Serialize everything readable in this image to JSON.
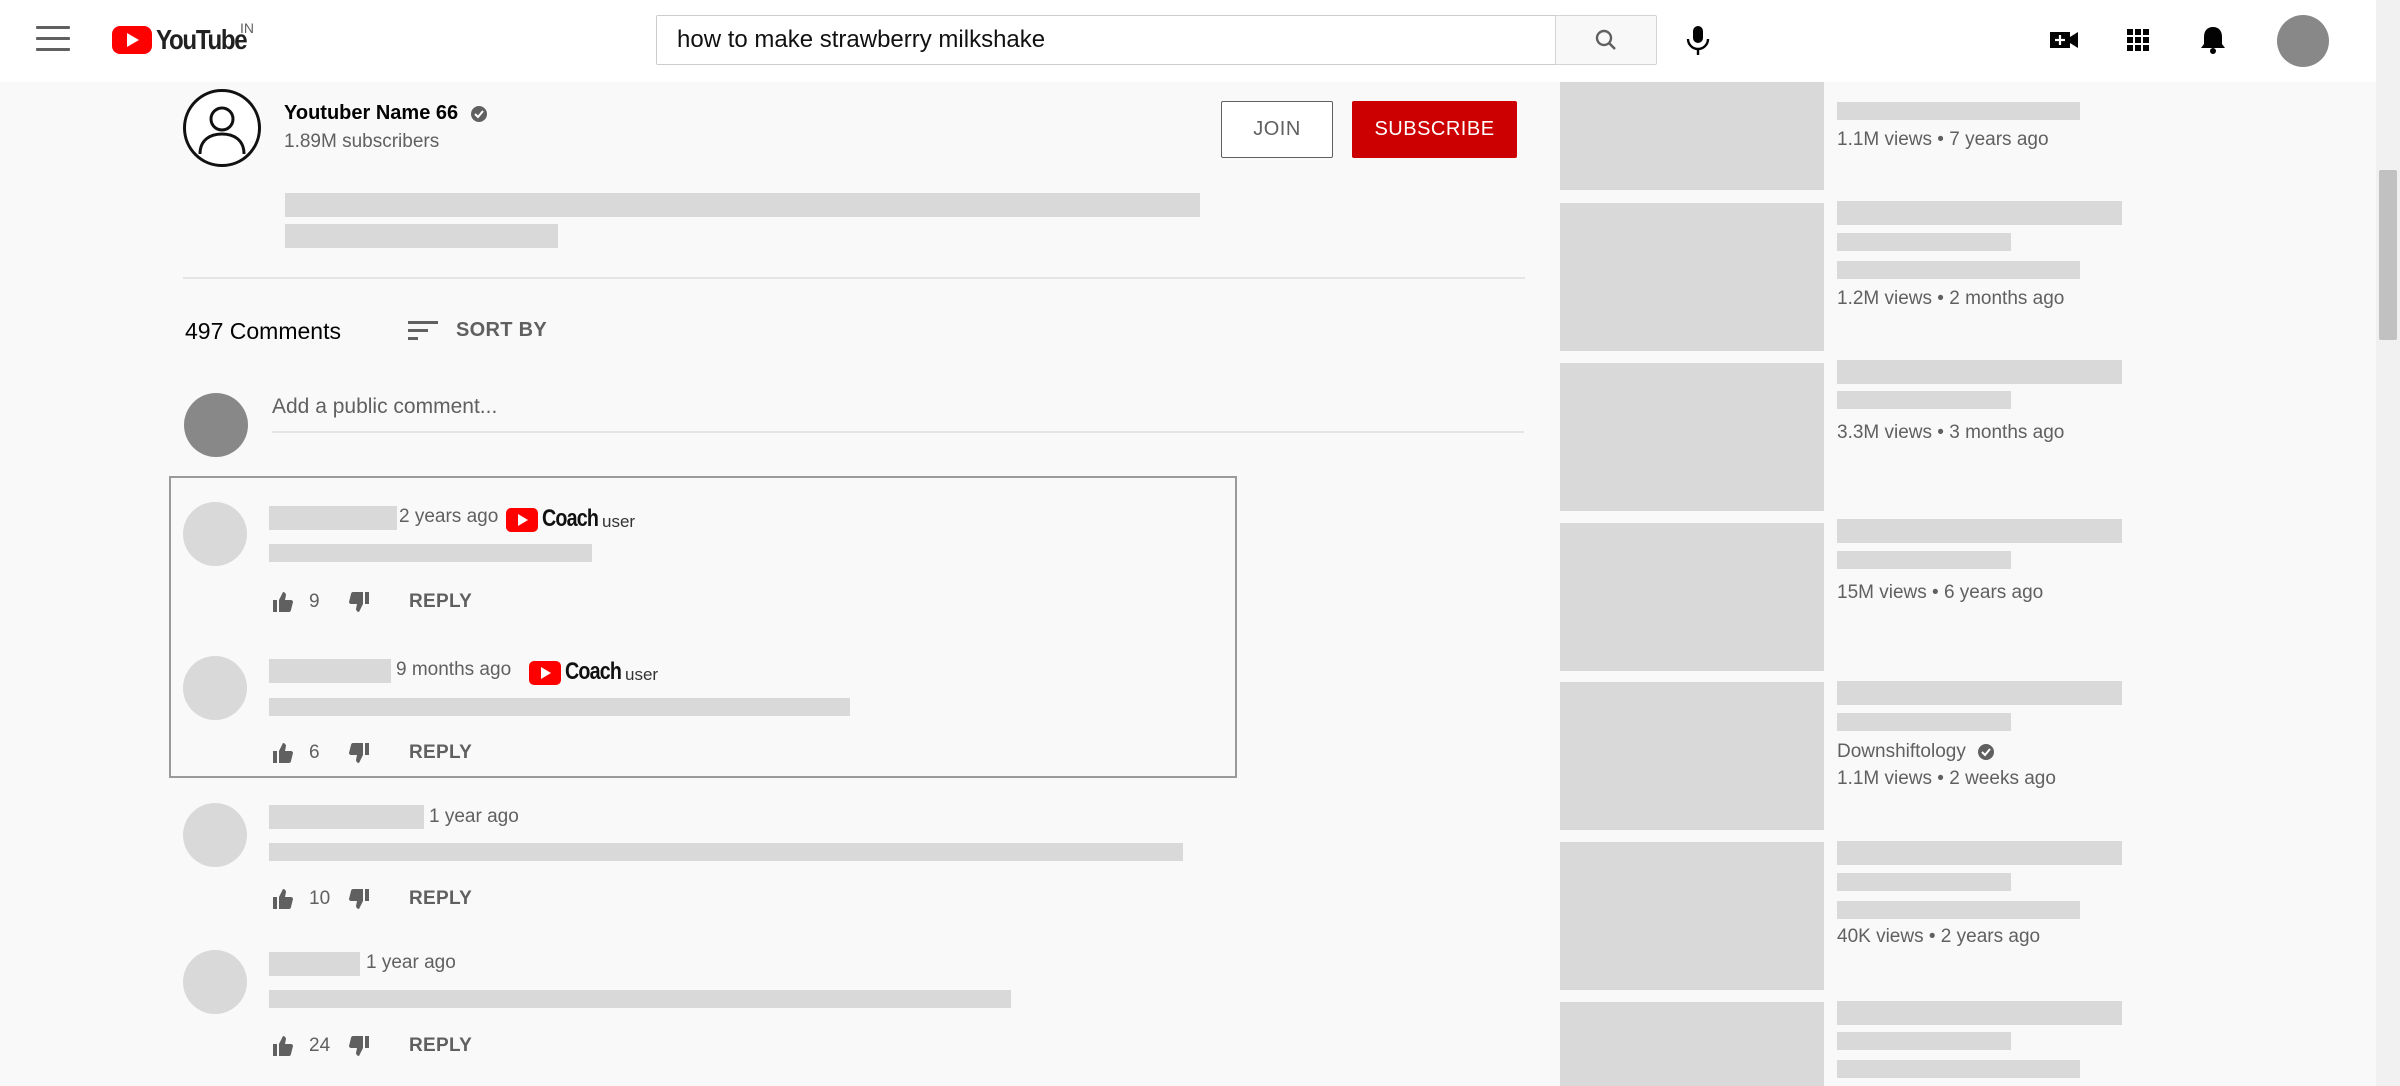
{
  "header": {
    "logo_text": "YouTube",
    "country": "IN",
    "search_value": "how to make strawberry milkshake"
  },
  "channel": {
    "name": "Youtuber Name 66",
    "subscribers": "1.89M subscribers",
    "join_label": "JOIN",
    "subscribe_label": "SUBSCRIBE"
  },
  "comments": {
    "count_label": "497 Comments",
    "sort_label": "SORT BY",
    "add_placeholder": "Add a public comment...",
    "items": [
      {
        "time": "2 years ago",
        "badge": "Coach",
        "badge_sub": "user",
        "likes": "9",
        "reply": "REPLY"
      },
      {
        "time": "9 months ago",
        "badge": "Coach",
        "badge_sub": "user",
        "likes": "6",
        "reply": "REPLY"
      },
      {
        "time": "1 year ago",
        "likes": "10",
        "reply": "REPLY"
      },
      {
        "time": "1 year ago",
        "likes": "24",
        "reply": "REPLY"
      }
    ]
  },
  "sidebar": {
    "items": [
      {
        "meta": "1.1M views • 7 years ago"
      },
      {
        "meta": "1.2M views • 2 months ago"
      },
      {
        "meta": "3.3M views • 3 months ago"
      },
      {
        "meta": "15M views • 6 years ago"
      },
      {
        "uploader": "Downshiftology",
        "meta": "1.1M views • 2 weeks ago"
      },
      {
        "meta": "40K views • 2 years ago"
      }
    ]
  },
  "colors": {
    "brand_red": "#ff0000",
    "subscribe_red": "#cc0000",
    "placeholder_gray": "#d9d9d9",
    "text_secondary": "#606060"
  }
}
